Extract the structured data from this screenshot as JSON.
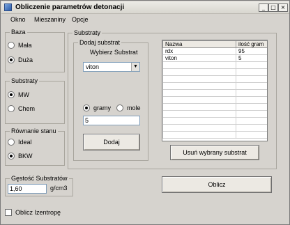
{
  "window": {
    "title": "Obliczenie parametrów detonacji"
  },
  "titlebar_buttons": {
    "minimize": "_",
    "maximize": "□",
    "close": "×"
  },
  "menu": [
    "Okno",
    "Mieszaniny",
    "Opcje"
  ],
  "baza": {
    "title": "Baza",
    "options": [
      {
        "label": "Mała",
        "selected": false
      },
      {
        "label": "Duża",
        "selected": true
      }
    ]
  },
  "substraty_left": {
    "title": "Substraty",
    "options": [
      {
        "label": "MW",
        "selected": true
      },
      {
        "label": "Chem",
        "selected": false
      }
    ]
  },
  "rownanie": {
    "title": "Równanie stanu",
    "options": [
      {
        "label": "Ideal",
        "selected": false
      },
      {
        "label": "BKW",
        "selected": true
      }
    ]
  },
  "gestosc": {
    "title": "Gęstość Substratów",
    "value": "1,60",
    "unit": "g/cm3"
  },
  "izentrope": {
    "label": "Oblicz Izentropę",
    "checked": false
  },
  "substraty_panel": {
    "title": "Substraty",
    "dodaj": {
      "title": "Dodaj substrat",
      "select_label": "Wybierz Substrat",
      "selected_value": "viton",
      "units": [
        {
          "label": "gramy",
          "selected": true
        },
        {
          "label": "mole",
          "selected": false
        }
      ],
      "amount": "5",
      "add_button": "Dodaj"
    },
    "grid": {
      "columns": [
        "Nazwa",
        "ilość gram"
      ],
      "rows": [
        [
          "rdx",
          "95"
        ],
        [
          "viton",
          "5"
        ]
      ]
    },
    "remove_button": "Usuń wybrany substrat"
  },
  "oblicz_button": "Oblicz"
}
